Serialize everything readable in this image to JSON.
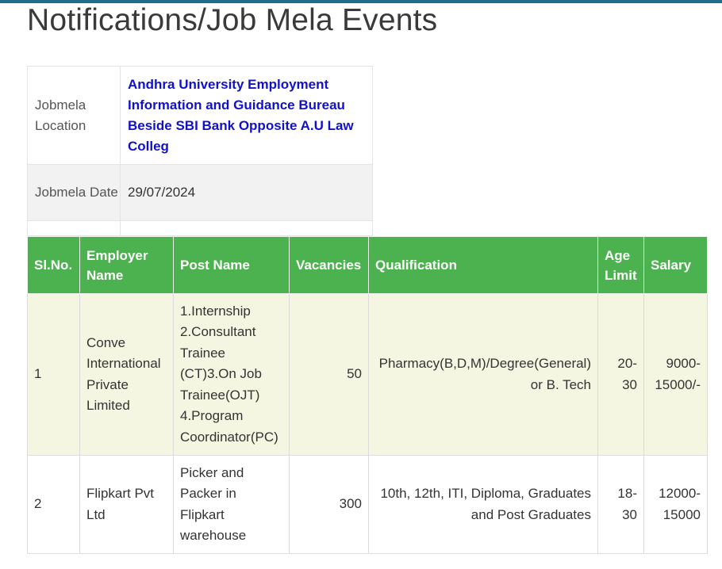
{
  "page": {
    "title": "Notifications/Job Mela Events"
  },
  "info": {
    "location_label": "Jobmela Location",
    "location_value": "Andhra University Employment Information and Guidance Bureau Beside SBI Bank Opposite A.U Law Colleg",
    "date_label": "Jobmela Date",
    "date_value": "29/07/2024"
  },
  "table": {
    "headers": [
      "Sl.No.",
      "Employer Name",
      "Post Name",
      "Vacancies",
      "Qualification",
      "Age Limit",
      "Salary"
    ],
    "rows": [
      {
        "sl": "1",
        "employer": "Conve International Private Limited",
        "post_lines": [
          "1.Internship",
          "2.Consultant Trainee (CT)3.On Job Trainee(OJT)",
          "4.Program Coordinator(PC)"
        ],
        "vacancies": "50",
        "qualification": "Pharmacy(B,D,M)/Degree(General) or B. Tech",
        "age": "20-30",
        "salary": "9000-15000/-"
      },
      {
        "sl": "2",
        "employer": "Flipkart Pvt Ltd",
        "post_lines": [
          "Picker and Packer in Flipkart warehouse"
        ],
        "vacancies": "300",
        "qualification": "10th, 12th, ITI, Diploma, Graduates and Post Graduates",
        "age": "18-30",
        "salary": "12000-15000"
      }
    ]
  },
  "colors": {
    "header_bg": "#4cb24f",
    "row_alt_bg": "#f5f6e2",
    "link": "#1111cc",
    "top_bar": "#1f6c8c"
  }
}
